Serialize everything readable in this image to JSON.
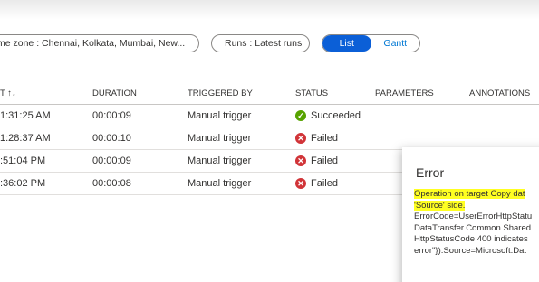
{
  "filters": {
    "timezone_label": "me zone : Chennai, Kolkata, Mumbai, New...",
    "runs_label": "Runs : Latest runs"
  },
  "view_toggle": {
    "list": "List",
    "gantt": "Gantt"
  },
  "table": {
    "headers": {
      "run_start": "T ↑↓",
      "duration": "DURATION",
      "triggered_by": "TRIGGERED BY",
      "status": "STATUS",
      "parameters": "PARAMETERS",
      "annotations": "ANNOTATIONS"
    },
    "rows": [
      {
        "run_start": "1:31:25 AM",
        "duration": "00:00:09",
        "triggered_by": "Manual trigger",
        "status": "Succeeded",
        "status_icon": "check-circle-icon"
      },
      {
        "run_start": "1:28:37 AM",
        "duration": "00:00:10",
        "triggered_by": "Manual trigger",
        "status": "Failed",
        "status_icon": "error-circle-icon"
      },
      {
        "run_start": ":51:04 PM",
        "duration": "00:00:09",
        "triggered_by": "Manual trigger",
        "status": "Failed",
        "status_icon": "error-circle-icon"
      },
      {
        "run_start": ":36:02 PM",
        "duration": "00:00:08",
        "triggered_by": "Manual trigger",
        "status": "Failed",
        "status_icon": "error-circle-icon"
      }
    ]
  },
  "error_panel": {
    "title": "Error",
    "highlight_line1": "Operation on target Copy dat",
    "highlight_line2": "'Source' side.",
    "lines": [
      "ErrorCode=UserErrorHttpStatu",
      "DataTransfer.Common.Shared",
      "HttpStatusCode 400 indicates",
      "error\"}).Source=Microsoft.Dat"
    ]
  },
  "colors": {
    "accent": "#0b5fd7",
    "success": "#57a300",
    "failed": "#d13438",
    "highlight": "#ffff22"
  }
}
